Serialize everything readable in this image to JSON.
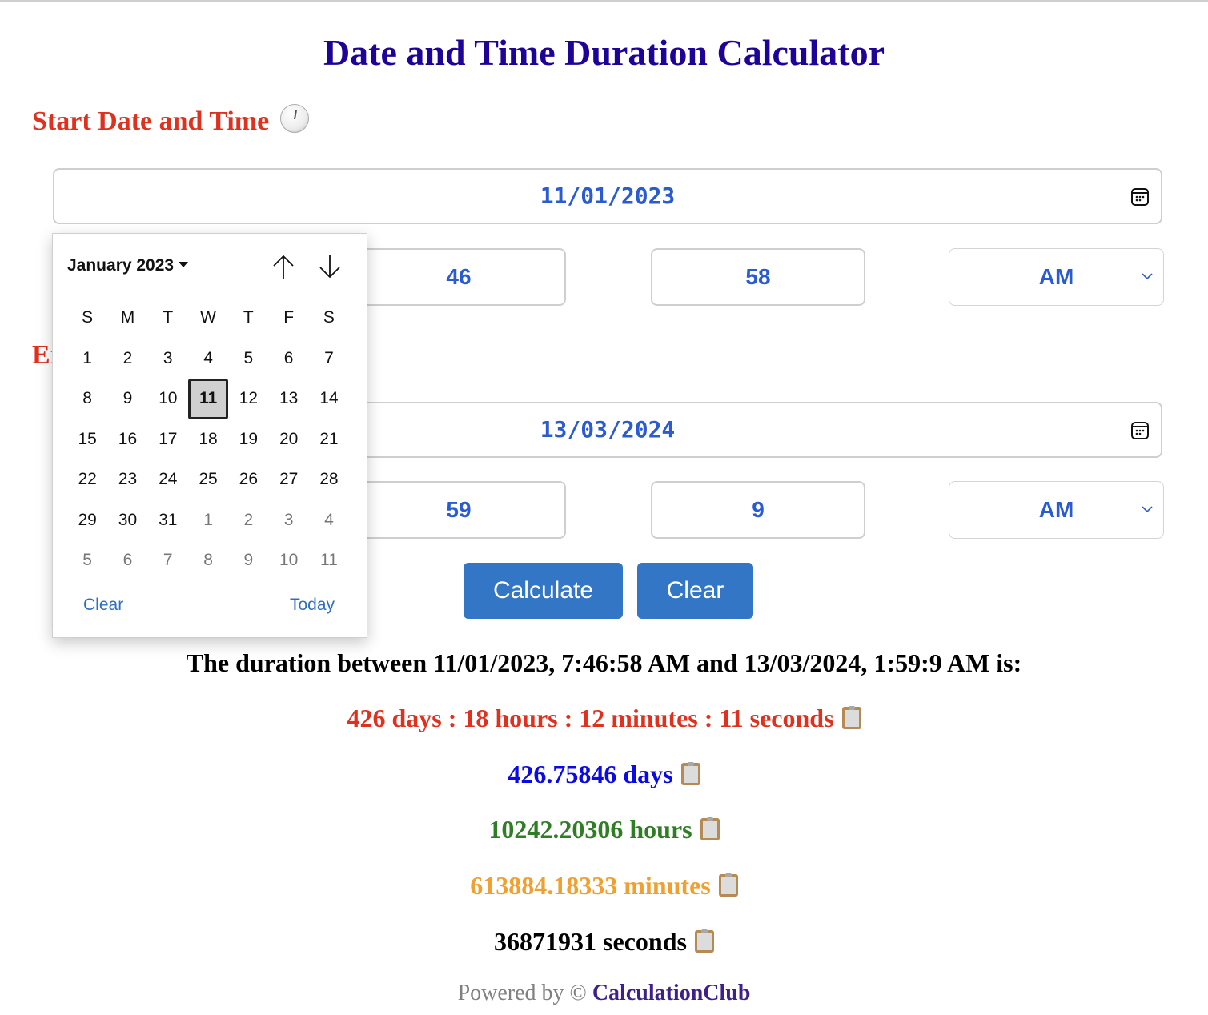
{
  "page": {
    "title": "Date and Time Duration Calculator"
  },
  "start": {
    "label": "Start Date and Time",
    "date": "11/01/2023",
    "hour": "7",
    "minute": "46",
    "second": "58",
    "ampm": "AM"
  },
  "end": {
    "label": "End Date and Time",
    "date": "13/03/2024",
    "hour": "1",
    "minute": "59",
    "second": "9",
    "ampm": "AM"
  },
  "buttons": {
    "calculate": "Calculate",
    "clear": "Clear"
  },
  "datepicker": {
    "month_label": "January 2023",
    "weekdays": [
      "S",
      "M",
      "T",
      "W",
      "T",
      "F",
      "S"
    ],
    "days": [
      {
        "d": "1",
        "other": false
      },
      {
        "d": "2",
        "other": false
      },
      {
        "d": "3",
        "other": false
      },
      {
        "d": "4",
        "other": false
      },
      {
        "d": "5",
        "other": false
      },
      {
        "d": "6",
        "other": false
      },
      {
        "d": "7",
        "other": false
      },
      {
        "d": "8",
        "other": false
      },
      {
        "d": "9",
        "other": false
      },
      {
        "d": "10",
        "other": false
      },
      {
        "d": "11",
        "other": false,
        "selected": true
      },
      {
        "d": "12",
        "other": false
      },
      {
        "d": "13",
        "other": false
      },
      {
        "d": "14",
        "other": false
      },
      {
        "d": "15",
        "other": false
      },
      {
        "d": "16",
        "other": false
      },
      {
        "d": "17",
        "other": false
      },
      {
        "d": "18",
        "other": false
      },
      {
        "d": "19",
        "other": false
      },
      {
        "d": "20",
        "other": false
      },
      {
        "d": "21",
        "other": false
      },
      {
        "d": "22",
        "other": false
      },
      {
        "d": "23",
        "other": false
      },
      {
        "d": "24",
        "other": false
      },
      {
        "d": "25",
        "other": false
      },
      {
        "d": "26",
        "other": false
      },
      {
        "d": "27",
        "other": false
      },
      {
        "d": "28",
        "other": false
      },
      {
        "d": "29",
        "other": false
      },
      {
        "d": "30",
        "other": false
      },
      {
        "d": "31",
        "other": false
      },
      {
        "d": "1",
        "other": true
      },
      {
        "d": "2",
        "other": true
      },
      {
        "d": "3",
        "other": true
      },
      {
        "d": "4",
        "other": true
      },
      {
        "d": "5",
        "other": true
      },
      {
        "d": "6",
        "other": true
      },
      {
        "d": "7",
        "other": true
      },
      {
        "d": "8",
        "other": true
      },
      {
        "d": "9",
        "other": true
      },
      {
        "d": "10",
        "other": true
      },
      {
        "d": "11",
        "other": true
      }
    ],
    "clear_label": "Clear",
    "today_label": "Today"
  },
  "results": {
    "summary": "The duration between 11/01/2023, 7:46:58 AM and 13/03/2024, 1:59:9 AM is:",
    "breakdown": "426 days : 18 hours : 12 minutes : 11 seconds",
    "days": "426.75846 days",
    "hours": "10242.20306 hours",
    "minutes": "613884.18333 minutes",
    "seconds": "36871931 seconds"
  },
  "colors": {
    "title": "#1f0399",
    "section_label": "#e0301e",
    "input_text": "#2a5bd0",
    "button": "#3476c6",
    "breakdown": "#e0301e",
    "days": "#0a0ae8",
    "hours": "#2f7d25",
    "minutes": "#f0a030",
    "seconds": "#000000",
    "brand": "#3f1f8a"
  },
  "footer": {
    "prefix": "Powered by ©",
    "brand": "CalculationClub"
  }
}
